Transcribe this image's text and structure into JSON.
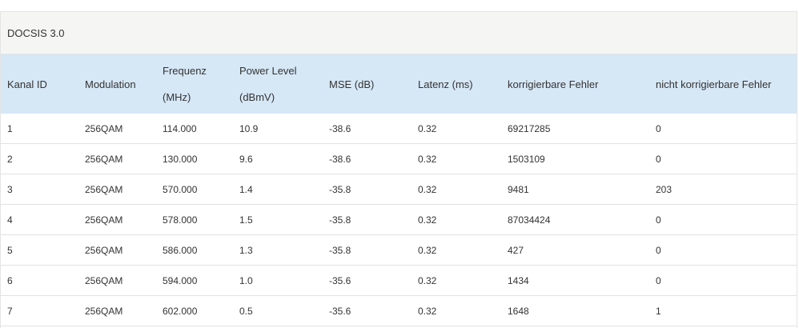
{
  "panel": {
    "title": "DOCSIS 3.0"
  },
  "table": {
    "headers": {
      "channel_id": "Kanal ID",
      "modulation": "Modulation",
      "frequency_line1": "Frequenz",
      "frequency_line2": "(MHz)",
      "power_line1": "Power Level",
      "power_line2": "(dBmV)",
      "mse": "MSE (dB)",
      "latency": "Latenz (ms)",
      "correctable": "korrigierbare Fehler",
      "uncorrectable": "nicht korrigierbare Fehler"
    },
    "rows": [
      {
        "id": "1",
        "modulation": "256QAM",
        "frequency": "114.000",
        "power": "10.9",
        "mse": "-38.6",
        "latency": "0.32",
        "correctable": "69217285",
        "uncorrectable": "0"
      },
      {
        "id": "2",
        "modulation": "256QAM",
        "frequency": "130.000",
        "power": "9.6",
        "mse": "-38.6",
        "latency": "0.32",
        "correctable": "1503109",
        "uncorrectable": "0"
      },
      {
        "id": "3",
        "modulation": "256QAM",
        "frequency": "570.000",
        "power": "1.4",
        "mse": "-35.8",
        "latency": "0.32",
        "correctable": "9481",
        "uncorrectable": "203"
      },
      {
        "id": "4",
        "modulation": "256QAM",
        "frequency": "578.000",
        "power": "1.5",
        "mse": "-35.8",
        "latency": "0.32",
        "correctable": "87034424",
        "uncorrectable": "0"
      },
      {
        "id": "5",
        "modulation": "256QAM",
        "frequency": "586.000",
        "power": "1.3",
        "mse": "-35.8",
        "latency": "0.32",
        "correctable": "427",
        "uncorrectable": "0"
      },
      {
        "id": "6",
        "modulation": "256QAM",
        "frequency": "594.000",
        "power": "1.0",
        "mse": "-35.6",
        "latency": "0.32",
        "correctable": "1434",
        "uncorrectable": "0"
      },
      {
        "id": "7",
        "modulation": "256QAM",
        "frequency": "602.000",
        "power": "0.5",
        "mse": "-35.6",
        "latency": "0.32",
        "correctable": "1648",
        "uncorrectable": "1"
      }
    ]
  }
}
